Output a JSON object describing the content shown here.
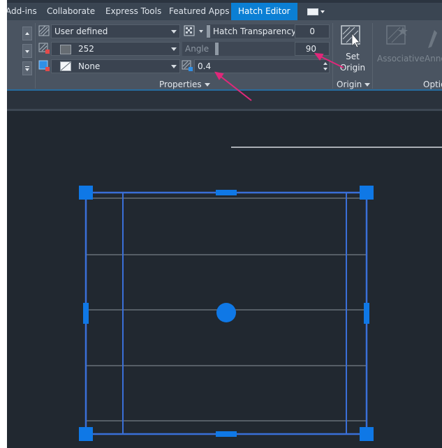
{
  "tabs": [
    {
      "label": "Add-ins",
      "active": false
    },
    {
      "label": "Collaborate",
      "active": false
    },
    {
      "label": "Express Tools",
      "active": false
    },
    {
      "label": "Featured Apps",
      "active": false
    },
    {
      "label": "Hatch Editor",
      "active": true
    }
  ],
  "properties": {
    "pattern_type": "User defined",
    "hatch_color": "252",
    "background_color": "None",
    "transparency_label": "Hatch Transparency",
    "transparency_value": "0",
    "angle_label": "Angle",
    "angle_value": "90",
    "spacing_value": "0.4",
    "panel_title": "Properties"
  },
  "origin": {
    "button_line1": "Set",
    "button_line2": "Origin",
    "panel_title": "Origin"
  },
  "options": {
    "associative_label": "Associative",
    "annotative_label": "Anno",
    "panel_title": "Optio"
  },
  "colors": {
    "accent": "#0b7fd4",
    "grip": "#0f78e6",
    "boundary": "#3a6fd8",
    "annotation_arrow": "#e0287a",
    "canvas_bg": "#212830",
    "ribbon_bg": "#4a5461"
  }
}
